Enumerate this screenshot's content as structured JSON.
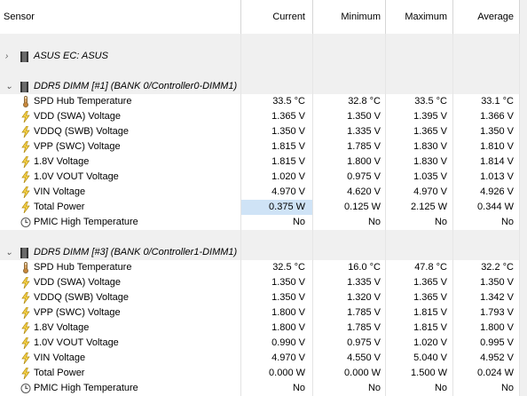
{
  "headers": [
    "Sensor",
    "Current",
    "Minimum",
    "Maximum",
    "Average"
  ],
  "groups": [
    {
      "title": "ASUS EC: ASUS",
      "expanded": false,
      "chevron": "›",
      "icon": "chip-icon",
      "rows": []
    },
    {
      "title": "DDR5 DIMM [#1] (BANK 0/Controller0-DIMM1)",
      "expanded": true,
      "chevron": "⌄",
      "icon": "memory-module-icon",
      "rows": [
        {
          "icon": "thermometer-icon",
          "name": "SPD Hub Temperature",
          "current": "33.5 °C",
          "min": "32.8 °C",
          "max": "33.5 °C",
          "avg": "33.1 °C"
        },
        {
          "icon": "lightning-icon",
          "name": "VDD (SWA) Voltage",
          "current": "1.365 V",
          "min": "1.350 V",
          "max": "1.395 V",
          "avg": "1.366 V"
        },
        {
          "icon": "lightning-icon",
          "name": "VDDQ (SWB) Voltage",
          "current": "1.350 V",
          "min": "1.335 V",
          "max": "1.365 V",
          "avg": "1.350 V"
        },
        {
          "icon": "lightning-icon",
          "name": "VPP (SWC) Voltage",
          "current": "1.815 V",
          "min": "1.785 V",
          "max": "1.830 V",
          "avg": "1.810 V"
        },
        {
          "icon": "lightning-icon",
          "name": "1.8V Voltage",
          "current": "1.815 V",
          "min": "1.800 V",
          "max": "1.830 V",
          "avg": "1.814 V"
        },
        {
          "icon": "lightning-icon",
          "name": "1.0V VOUT Voltage",
          "current": "1.020 V",
          "min": "0.975 V",
          "max": "1.035 V",
          "avg": "1.013 V"
        },
        {
          "icon": "lightning-icon",
          "name": "VIN Voltage",
          "current": "4.970 V",
          "min": "4.620 V",
          "max": "4.970 V",
          "avg": "4.926 V"
        },
        {
          "icon": "lightning-icon",
          "name": "Total Power",
          "current": "0.375 W",
          "min": "0.125 W",
          "max": "2.125 W",
          "avg": "0.344 W",
          "highlight": true
        },
        {
          "icon": "clock-icon",
          "name": "PMIC High Temperature",
          "current": "No",
          "min": "No",
          "max": "No",
          "avg": "No"
        }
      ]
    },
    {
      "title": "DDR5 DIMM [#3] (BANK 0/Controller1-DIMM1)",
      "expanded": true,
      "chevron": "⌄",
      "icon": "memory-module-icon",
      "rows": [
        {
          "icon": "thermometer-icon",
          "name": "SPD Hub Temperature",
          "current": "32.5 °C",
          "min": "16.0 °C",
          "max": "47.8 °C",
          "avg": "32.2 °C"
        },
        {
          "icon": "lightning-icon",
          "name": "VDD (SWA) Voltage",
          "current": "1.350 V",
          "min": "1.335 V",
          "max": "1.365 V",
          "avg": "1.350 V"
        },
        {
          "icon": "lightning-icon",
          "name": "VDDQ (SWB) Voltage",
          "current": "1.350 V",
          "min": "1.320 V",
          "max": "1.365 V",
          "avg": "1.342 V"
        },
        {
          "icon": "lightning-icon",
          "name": "VPP (SWC) Voltage",
          "current": "1.800 V",
          "min": "1.785 V",
          "max": "1.815 V",
          "avg": "1.793 V"
        },
        {
          "icon": "lightning-icon",
          "name": "1.8V Voltage",
          "current": "1.800 V",
          "min": "1.785 V",
          "max": "1.815 V",
          "avg": "1.800 V"
        },
        {
          "icon": "lightning-icon",
          "name": "1.0V VOUT Voltage",
          "current": "0.990 V",
          "min": "0.975 V",
          "max": "1.020 V",
          "avg": "0.995 V"
        },
        {
          "icon": "lightning-icon",
          "name": "VIN Voltage",
          "current": "4.970 V",
          "min": "4.550 V",
          "max": "5.040 V",
          "avg": "4.952 V"
        },
        {
          "icon": "lightning-icon",
          "name": "Total Power",
          "current": "0.000 W",
          "min": "0.000 W",
          "max": "1.500 W",
          "avg": "0.024 W"
        },
        {
          "icon": "clock-icon",
          "name": "PMIC High Temperature",
          "current": "No",
          "min": "No",
          "max": "No",
          "avg": "No"
        }
      ]
    }
  ]
}
